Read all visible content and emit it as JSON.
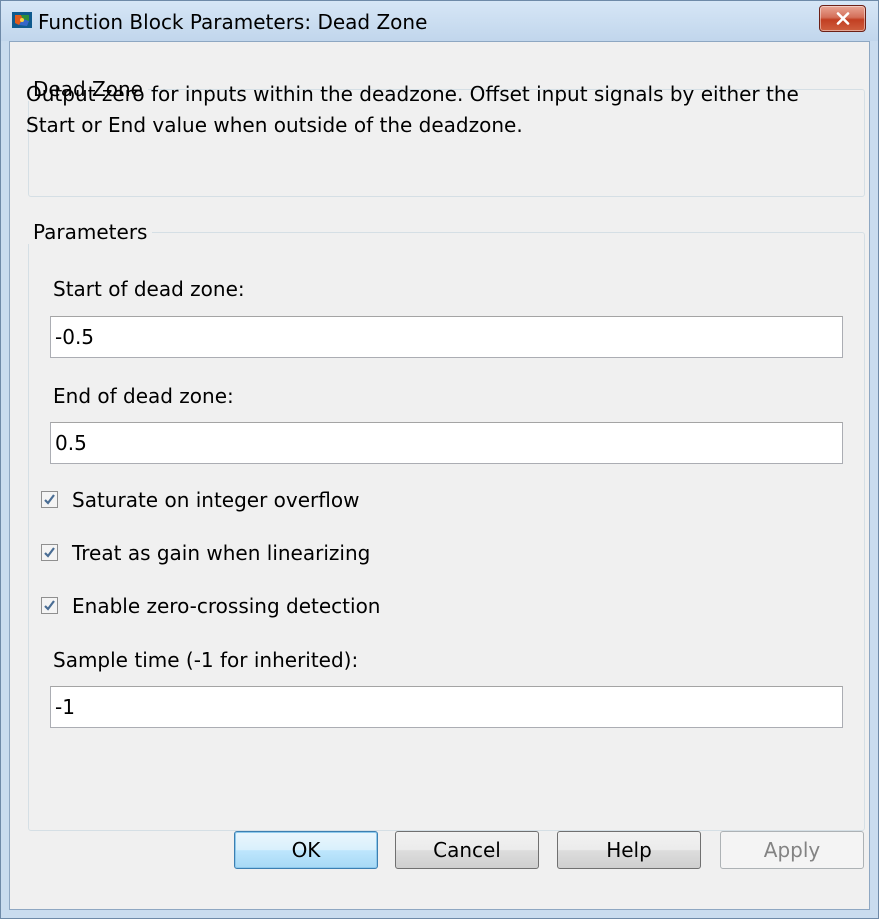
{
  "window": {
    "title": "Function Block Parameters: Dead Zone",
    "icon": "simulink-block-icon",
    "close_icon": "close-icon"
  },
  "description_group": {
    "title": "Dead Zone",
    "text": "Output zero for inputs within the deadzone.  Offset input signals by either the Start or End value when outside of the deadzone."
  },
  "parameters_group": {
    "title": "Parameters",
    "start_label": "Start of dead zone:",
    "start_value": "-0.5",
    "end_label": "End of dead zone:",
    "end_value": "0.5",
    "checkboxes": [
      {
        "label": "Saturate on integer overflow",
        "checked": true
      },
      {
        "label": "Treat as gain when linearizing",
        "checked": true
      },
      {
        "label": "Enable zero-crossing detection",
        "checked": true
      }
    ],
    "sample_time_label": "Sample time (-1 for inherited):",
    "sample_time_value": "-1"
  },
  "buttons": {
    "ok": "OK",
    "cancel": "Cancel",
    "help": "Help",
    "apply": "Apply",
    "apply_enabled": false
  },
  "colors": {
    "close_button": "#c94a2c",
    "default_button": "#3c7fb1",
    "check_mark": "#4a6d94"
  }
}
